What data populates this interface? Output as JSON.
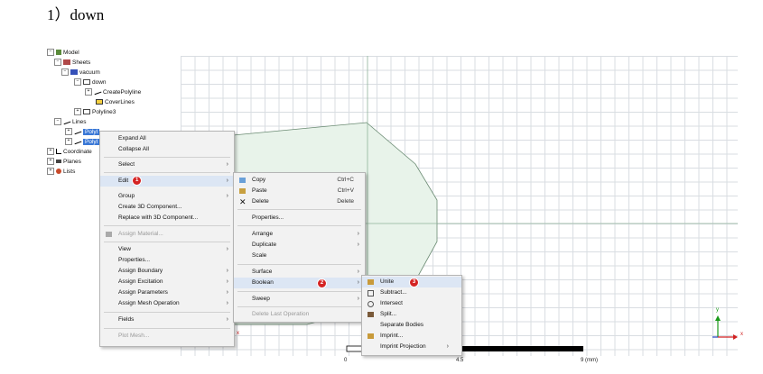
{
  "heading": "1）down",
  "tree": {
    "model": "Model",
    "sheets": "Sheets",
    "vacuum": "vacuum",
    "down": "down",
    "create_polyline": "CreatePolyline",
    "cover_lines": "CoverLines",
    "polyline3": "Polyline3",
    "lines": "Lines",
    "polyline_a": "Polyl",
    "polyline_b": "Polyl",
    "coordinate": "Coordinate",
    "planes": "Planes",
    "lists": "Lists"
  },
  "context_menu": {
    "expand_all": "Expand All",
    "collapse_all": "Collapse All",
    "select": "Select",
    "edit": "Edit",
    "edit_badge": "1",
    "group": "Group",
    "create_3d": "Create 3D Component...",
    "replace_3d": "Replace with 3D Component...",
    "assign_material": "Assign Material...",
    "view": "View",
    "properties": "Properties...",
    "assign_boundary": "Assign Boundary",
    "assign_excitation": "Assign Excitation",
    "assign_parameters": "Assign Parameters",
    "assign_mesh": "Assign Mesh Operation",
    "fields": "Fields",
    "plot_mesh": "Plot Mesh..."
  },
  "edit_menu": {
    "copy": "Copy",
    "copy_sc": "Ctrl+C",
    "paste": "Paste",
    "paste_sc": "Ctrl+V",
    "delete": "Delete",
    "delete_sc": "Delete",
    "properties": "Properties...",
    "arrange": "Arrange",
    "duplicate": "Duplicate",
    "scale": "Scale",
    "surface": "Surface",
    "boolean": "Boolean",
    "boolean_badge": "2",
    "sweep": "Sweep",
    "delete_last": "Delete Last Operation"
  },
  "boolean_menu": {
    "unite": "Unite",
    "unite_badge": "3",
    "subtract": "Subtract...",
    "intersect": "Intersect",
    "split": "Split...",
    "separate": "Separate Bodies",
    "imprint": "Imprint...",
    "imprint_projection": "Imprint Projection"
  },
  "scale_bar": {
    "t0": "0",
    "t1": "4.5",
    "t2": "9 (mm)"
  },
  "axes": {
    "x": "x",
    "y": "y"
  },
  "colors": {
    "badge": "#d42424",
    "selection": "#3a78d6",
    "shape_fill": "#e8f3ea"
  }
}
